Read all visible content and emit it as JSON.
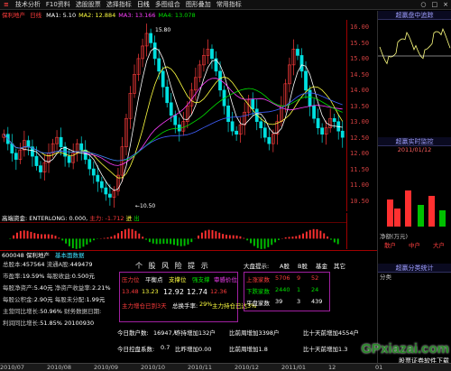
{
  "menu": {
    "logo": "≡",
    "items": [
      "技术分析",
      "F10资料",
      "选股股票",
      "选择指标",
      "日线",
      "多图组合",
      "图形叠加",
      "常用指标"
    ],
    "right_items": [
      "○",
      "□",
      "×"
    ]
  },
  "title": {
    "stock": "保利地产",
    "period": "日线",
    "ma": [
      {
        "label": "MA1: 5.10",
        "color": "#ffffff"
      },
      {
        "label": "MA2: 12.884",
        "color": "#ffff40"
      },
      {
        "label": "MA3: 13.166",
        "color": "#ff40ff"
      },
      {
        "label": "MA4: 13.078",
        "color": "#00e000"
      }
    ]
  },
  "price_ticks": [
    "16.00",
    "15.50",
    "15.00",
    "14.50",
    "14.00",
    "13.50",
    "13.00",
    "12.50",
    "12.00",
    "11.50",
    "11.00",
    "10.50"
  ],
  "annotations": {
    "high_label": "15.80",
    "low_label": "10.50"
  },
  "indicator": {
    "title": "高端资金: ENTERLONG: 0.000,",
    "main_label": "主力:",
    "main_value": "-1.712",
    "in_label": "进",
    "out_label": "出"
  },
  "codebar": {
    "code": "600048",
    "name": "保利地产",
    "tab": "基本面数据"
  },
  "f10": {
    "rows": [
      {
        "label": "总股本:",
        "value": "457564",
        "label2": "流通A股:",
        "value2": "449479"
      },
      {
        "label": "市盈率:",
        "value": "19.59%",
        "label2": "每股收益:",
        "value2": "0.500元"
      },
      {
        "label": "每股净资产:",
        "value": "5.40元",
        "label2": "净资产收益率:",
        "value2": "2.21%"
      },
      {
        "label": "每股公积金:",
        "value": "2.90元",
        "label2": "每股未分配:",
        "value2": "1.99元"
      },
      {
        "label": "主营同比增长:",
        "value": "50.96%",
        "label2": "财务数据日期:",
        "value2": ""
      },
      {
        "label": "利润同比增长:",
        "value": "51.85%",
        "label2": "",
        "value2": "20100930"
      }
    ]
  },
  "risk": {
    "title": "个 股 风 险 提 示",
    "market_hint": "大盘提示:",
    "market_a": "A股",
    "market_b": "B股",
    "market_c": "基金",
    "market_d": "其它",
    "labels": {
      "press": "压力位",
      "pivot": "平衡点",
      "support": "支撑位",
      "strong": "强支撑",
      "weak": "审感价位"
    },
    "values": [
      "13.48",
      "13.23",
      "12.92",
      "12.74",
      "12.36"
    ],
    "inflow_label": "主力增仓已到3天",
    "turnover_label": "总换手率:",
    "turnover_value": "29%",
    "main_label": "主力持仓已达3%",
    "market_panel": {
      "up_label": "上涨家数",
      "up_values": [
        "5706",
        "9",
        "52"
      ],
      "down_label": "下跌家数",
      "down_values": [
        "2440",
        "1",
        "24"
      ],
      "flat_label": "平盘家数",
      "flat_values": [
        "39",
        "3",
        "439"
      ]
    },
    "stats": [
      {
        "label": "今日散户数:",
        "value": "16947人",
        "text": "昨持增加132户",
        "t2": "比前周增加3398户",
        "t3": "比十天前增加4554户"
      },
      {
        "label": "今日控盘系数:",
        "value": "0.7",
        "text": "比昨增加0.00",
        "t2": "比前周增加1.8",
        "t3": "比十天前增加1.3"
      }
    ]
  },
  "right_panel": {
    "top_title": "超赢盘中追踪",
    "mid_title": "超赢实时监控",
    "mid_date": "2011/01/12",
    "fund_title": "净额(万元)",
    "fund_labels": [
      "散户",
      "中户",
      "大户"
    ],
    "bottom_title": "超赢分类统计",
    "bottom_label": "分类"
  },
  "statusbar": {
    "items": [
      "2010/07",
      "2010/08",
      "2010/09",
      "2010/10",
      "2010/11",
      "2010/12",
      "2011/01",
      "12"
    ],
    "right": "01"
  },
  "watermark": {
    "site": "GPxiazai.com",
    "sub": "股票证券软件下载"
  },
  "colors": {
    "up": "#ff3c3c",
    "down": "#00e0e0",
    "ma5": "#ffffff",
    "ma10": "#ffff40",
    "ma20": "#ff40ff",
    "ma60": "#00e000",
    "ma120": "#4060ff"
  }
}
